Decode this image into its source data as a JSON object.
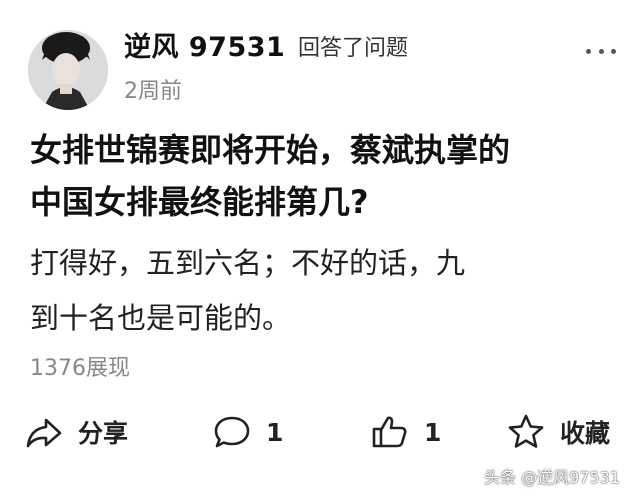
{
  "user": {
    "name": "逆风 97531",
    "action": "回答了问题",
    "time": "2周前"
  },
  "post": {
    "question_line1": "女排世锦赛即将开始，蔡斌执掌的",
    "question_line2": "中国女排最终能排第几?",
    "answer_line1": "打得好，五到六名；不好的话，九",
    "answer_line2": "到十名也是可能的。",
    "views": "1376展现"
  },
  "actions": {
    "share_label": "分享",
    "comment_count": "1",
    "like_count": "1",
    "favorite_label": "收藏"
  },
  "icons": {
    "more": "more-horizontal-icon",
    "share": "share-arrow-icon",
    "comment": "comment-bubble-icon",
    "like": "thumbs-up-icon",
    "favorite": "star-icon"
  },
  "watermark": "头条 @逆风97531"
}
